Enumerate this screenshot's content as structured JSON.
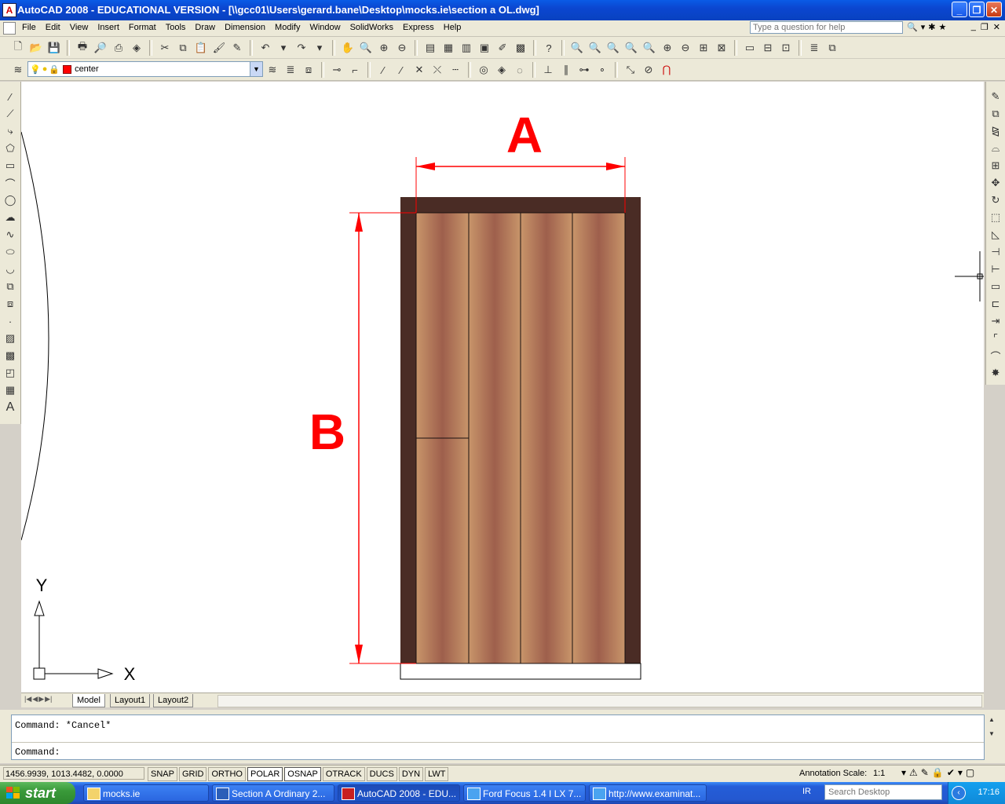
{
  "window": {
    "title": "AutoCAD 2008 - EDUCATIONAL VERSION - [\\\\gcc01\\Users\\gerard.bane\\Desktop\\mocks.ie\\section a OL.dwg]",
    "app_icon_letter": "A"
  },
  "menu": {
    "items": [
      "File",
      "Edit",
      "View",
      "Insert",
      "Format",
      "Tools",
      "Draw",
      "Dimension",
      "Modify",
      "Window",
      "SolidWorks",
      "Express",
      "Help"
    ],
    "help_placeholder": "Type a question for help"
  },
  "layer": {
    "name": "center",
    "color": "#ff0000"
  },
  "drawing": {
    "dim_a_label": "A",
    "dim_b_label": "B",
    "dim_color": "#ff0000",
    "frame_color": "#4a2c25",
    "panel_light": "#c8956a",
    "panel_dark": "#9e5f4c",
    "ucs_x": "X",
    "ucs_y": "Y"
  },
  "layout_tabs": [
    "Model",
    "Layout1",
    "Layout2"
  ],
  "command": {
    "history": "Command: *Cancel*",
    "prompt": "Command:"
  },
  "status": {
    "coords": "1456.9939, 1013.4482, 0.0000",
    "toggles": [
      {
        "label": "SNAP",
        "on": false
      },
      {
        "label": "GRID",
        "on": false
      },
      {
        "label": "ORTHO",
        "on": false
      },
      {
        "label": "POLAR",
        "on": true
      },
      {
        "label": "OSNAP",
        "on": true
      },
      {
        "label": "OTRACK",
        "on": false
      },
      {
        "label": "DUCS",
        "on": false
      },
      {
        "label": "DYN",
        "on": false
      },
      {
        "label": "LWT",
        "on": false
      }
    ],
    "annotation_scale_label": "Annotation Scale:",
    "annotation_scale_value": "1:1"
  },
  "taskbar": {
    "start_label": "start",
    "tasks": [
      {
        "label": "mocks.ie",
        "icon": "folder-icon",
        "active": false
      },
      {
        "label": "Section A Ordinary 2...",
        "icon": "word-icon",
        "active": false
      },
      {
        "label": "AutoCAD 2008 - EDU...",
        "icon": "autocad-icon",
        "active": true
      },
      {
        "label": "Ford Focus 1.4 I LX 7...",
        "icon": "ie-icon",
        "active": false
      },
      {
        "label": "http://www.examinat...",
        "icon": "ie-icon",
        "active": false
      }
    ],
    "language": "IR",
    "search_placeholder": "Search Desktop",
    "clock": "17:16"
  }
}
